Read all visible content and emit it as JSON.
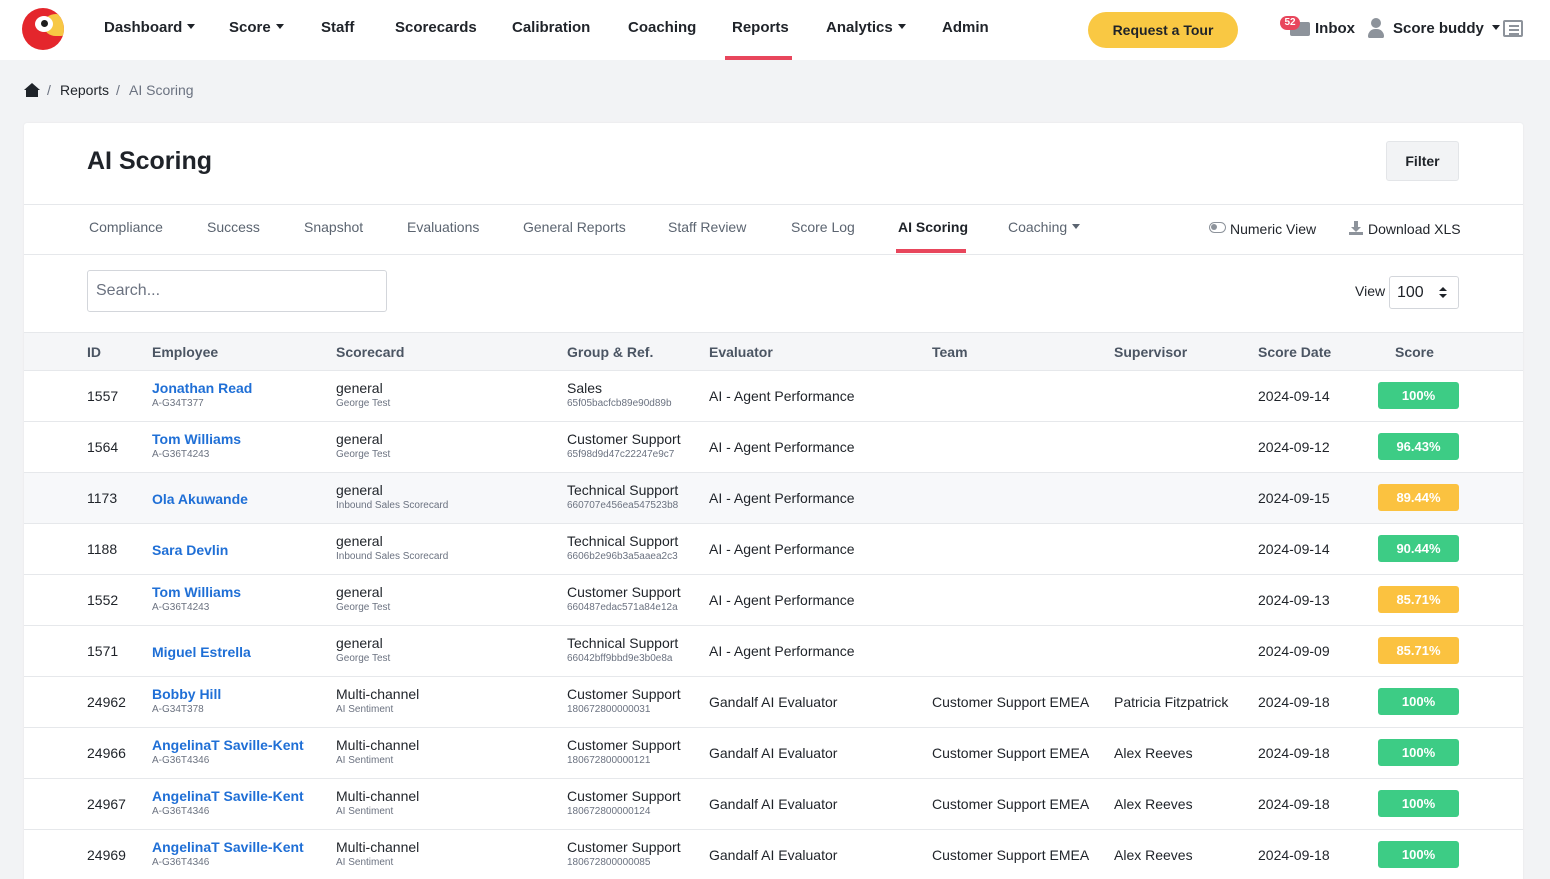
{
  "colors": {
    "accent": "#e8465c",
    "tour": "#f9c843",
    "link": "#1f6fd6",
    "score_green": "#3dcc85",
    "score_yellow": "#fbc240"
  },
  "topnav": {
    "items": [
      {
        "label": "Dashboard",
        "dropdown": true
      },
      {
        "label": "Score",
        "dropdown": true
      },
      {
        "label": "Staff",
        "dropdown": false
      },
      {
        "label": "Scorecards",
        "dropdown": false
      },
      {
        "label": "Calibration",
        "dropdown": false
      },
      {
        "label": "Coaching",
        "dropdown": false
      },
      {
        "label": "Reports",
        "dropdown": false,
        "active": true
      },
      {
        "label": "Analytics",
        "dropdown": true
      },
      {
        "label": "Admin",
        "dropdown": false
      }
    ],
    "tour_label": "Request a Tour",
    "inbox_count": "52",
    "inbox_label": "Inbox",
    "user_label": "Score buddy"
  },
  "breadcrumb": {
    "items": [
      "Reports",
      "AI Scoring"
    ]
  },
  "page": {
    "title": "AI Scoring",
    "filter_label": "Filter"
  },
  "tabs": {
    "items": [
      {
        "label": "Compliance"
      },
      {
        "label": "Success"
      },
      {
        "label": "Snapshot"
      },
      {
        "label": "Evaluations"
      },
      {
        "label": "General Reports"
      },
      {
        "label": "Staff Review"
      },
      {
        "label": "Score Log"
      },
      {
        "label": "AI Scoring",
        "active": true
      },
      {
        "label": "Coaching",
        "dropdown": true
      }
    ],
    "numeric_view": "Numeric View",
    "download": "Download XLS"
  },
  "search": {
    "placeholder": "Search...",
    "value": ""
  },
  "view": {
    "label": "View",
    "value": "100"
  },
  "table": {
    "headers": [
      "ID",
      "Employee",
      "Scorecard",
      "Group & Ref.",
      "Evaluator",
      "Team",
      "Supervisor",
      "Score Date",
      "Score"
    ],
    "rows": [
      {
        "id": "1557",
        "employee": "Jonathan Read",
        "emp_code": "A-G34T377",
        "scorecard": "general",
        "scorecard_sub": "George Test",
        "group": "Sales",
        "ref": "65f05bacfcb89e90d89b",
        "evaluator": "AI - Agent Performance",
        "team": "",
        "supervisor": "",
        "date": "2024-09-14",
        "score": "100%",
        "score_color": "#3dcc85"
      },
      {
        "id": "1564",
        "employee": "Tom Williams",
        "emp_code": "A-G36T4243",
        "scorecard": "general",
        "scorecard_sub": "George Test",
        "group": "Customer Support",
        "ref": "65f98d9d47c22247e9c7",
        "evaluator": "AI - Agent Performance",
        "team": "",
        "supervisor": "",
        "date": "2024-09-12",
        "score": "96.43%",
        "score_color": "#3dcc85"
      },
      {
        "id": "1173",
        "employee": "Ola Akuwande",
        "emp_code": "",
        "scorecard": "general",
        "scorecard_sub": "Inbound Sales Scorecard",
        "group": "Technical Support",
        "ref": "660707e456ea547523b8",
        "evaluator": "AI - Agent Performance",
        "team": "",
        "supervisor": "",
        "date": "2024-09-15",
        "score": "89.44%",
        "score_color": "#fbc240"
      },
      {
        "id": "1188",
        "employee": "Sara Devlin",
        "emp_code": "",
        "scorecard": "general",
        "scorecard_sub": "Inbound Sales Scorecard",
        "group": "Technical Support",
        "ref": "6606b2e96b3a5aaea2c3",
        "evaluator": "AI - Agent Performance",
        "team": "",
        "supervisor": "",
        "date": "2024-09-14",
        "score": "90.44%",
        "score_color": "#3dcc85"
      },
      {
        "id": "1552",
        "employee": "Tom Williams",
        "emp_code": "A-G36T4243",
        "scorecard": "general",
        "scorecard_sub": "George Test",
        "group": "Customer Support",
        "ref": "660487edac571a84e12a",
        "evaluator": "AI - Agent Performance",
        "team": "",
        "supervisor": "",
        "date": "2024-09-13",
        "score": "85.71%",
        "score_color": "#fbc240"
      },
      {
        "id": "1571",
        "employee": "Miguel Estrella",
        "emp_code": "",
        "scorecard": "general",
        "scorecard_sub": "George Test",
        "group": "Technical Support",
        "ref": "66042bff9bbd9e3b0e8a",
        "evaluator": "AI - Agent Performance",
        "team": "",
        "supervisor": "",
        "date": "2024-09-09",
        "score": "85.71%",
        "score_color": "#fbc240"
      },
      {
        "id": "24962",
        "employee": "Bobby Hill",
        "emp_code": "A-G34T378",
        "scorecard": "Multi-channel",
        "scorecard_sub": "AI Sentiment",
        "group": "Customer Support",
        "ref": "180672800000031",
        "evaluator": "Gandalf AI Evaluator",
        "team": "Customer Support EMEA",
        "supervisor": "Patricia Fitzpatrick",
        "date": "2024-09-18",
        "score": "100%",
        "score_color": "#3dcc85"
      },
      {
        "id": "24966",
        "employee": "AngelinaT Saville-Kent",
        "emp_code": "A-G36T4346",
        "scorecard": "Multi-channel",
        "scorecard_sub": "AI Sentiment",
        "group": "Customer Support",
        "ref": "180672800000121",
        "evaluator": "Gandalf AI Evaluator",
        "team": "Customer Support EMEA",
        "supervisor": "Alex Reeves",
        "date": "2024-09-18",
        "score": "100%",
        "score_color": "#3dcc85"
      },
      {
        "id": "24967",
        "employee": "AngelinaT Saville-Kent",
        "emp_code": "A-G36T4346",
        "scorecard": "Multi-channel",
        "scorecard_sub": "AI Sentiment",
        "group": "Customer Support",
        "ref": "180672800000124",
        "evaluator": "Gandalf AI Evaluator",
        "team": "Customer Support EMEA",
        "supervisor": "Alex Reeves",
        "date": "2024-09-18",
        "score": "100%",
        "score_color": "#3dcc85"
      },
      {
        "id": "24969",
        "employee": "AngelinaT Saville-Kent",
        "emp_code": "A-G36T4346",
        "scorecard": "Multi-channel",
        "scorecard_sub": "AI Sentiment",
        "group": "Customer Support",
        "ref": "180672800000085",
        "evaluator": "Gandalf AI Evaluator",
        "team": "Customer Support EMEA",
        "supervisor": "Alex Reeves",
        "date": "2024-09-18",
        "score": "100%",
        "score_color": "#3dcc85"
      }
    ]
  }
}
